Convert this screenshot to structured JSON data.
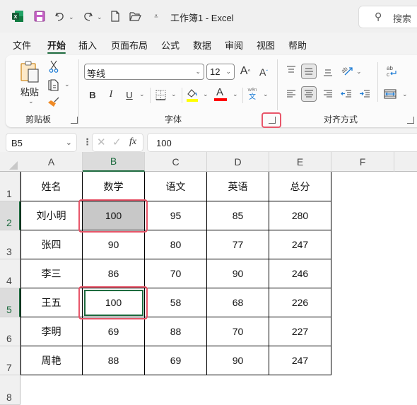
{
  "title_bar": {
    "app_icon": "excel-icon",
    "quick_access": [
      "save-icon",
      "undo-icon",
      "redo-icon",
      "new-file-icon",
      "open-folder-icon",
      "customize-qat-icon"
    ],
    "title": "工作簿1  -  Excel",
    "search_placeholder": "搜索"
  },
  "menu": {
    "tabs": [
      {
        "label": "文件",
        "active": false
      },
      {
        "label": "开始",
        "active": true
      },
      {
        "label": "插入",
        "active": false
      },
      {
        "label": "页面布局",
        "active": false
      },
      {
        "label": "公式",
        "active": false
      },
      {
        "label": "数据",
        "active": false
      },
      {
        "label": "审阅",
        "active": false
      },
      {
        "label": "视图",
        "active": false
      },
      {
        "label": "帮助",
        "active": false
      }
    ]
  },
  "ribbon": {
    "clipboard": {
      "label": "剪贴板",
      "paste_label": "粘贴",
      "chevron": "⌄"
    },
    "font": {
      "label": "字体",
      "font_name": "等线",
      "font_size": "12",
      "bold": "B",
      "italic": "I",
      "underline": "U",
      "font_color_glyph": "A",
      "increase_glyph": "A",
      "decrease_glyph": "A",
      "phonetic_top": "wén",
      "phonetic_bottom": "文",
      "fill_color": "#ffff00",
      "font_color": "#ff0000"
    },
    "alignment": {
      "label": "对齐方式"
    }
  },
  "formula_bar": {
    "name_box": "B5",
    "fx": "fx",
    "value": "100"
  },
  "sheet": {
    "columns": [
      "A",
      "B",
      "C",
      "D",
      "E",
      "F"
    ],
    "selected_column": "B",
    "rows": [
      "1",
      "2",
      "3",
      "4",
      "5",
      "6",
      "7",
      "8"
    ],
    "selected_rows": [
      "2",
      "5"
    ],
    "table": {
      "headers": [
        "姓名",
        "数学",
        "语文",
        "英语",
        "总分"
      ],
      "data": [
        [
          "刘小明",
          "100",
          "95",
          "85",
          "280"
        ],
        [
          "张四",
          "90",
          "80",
          "77",
          "247"
        ],
        [
          "李三",
          "86",
          "70",
          "90",
          "246"
        ],
        [
          "王五",
          "100",
          "58",
          "68",
          "226"
        ],
        [
          "李明",
          "69",
          "88",
          "70",
          "227"
        ],
        [
          "周艳",
          "88",
          "69",
          "90",
          "247"
        ]
      ]
    },
    "active_cell": "B5",
    "filled_cell": "B2",
    "fill_color": "#c8c8c8",
    "highlight_color": "#e8566a"
  }
}
